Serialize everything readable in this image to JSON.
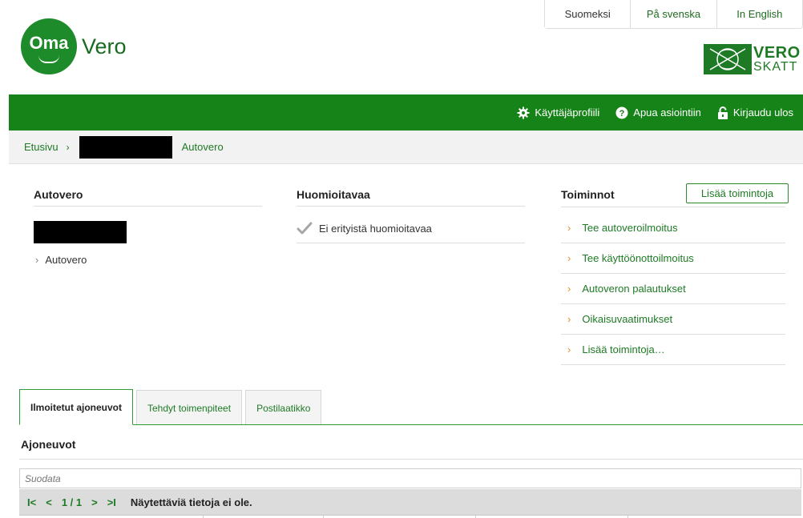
{
  "languages": [
    {
      "label": "Suomeksi",
      "active": true
    },
    {
      "label": "På svenska",
      "active": false
    },
    {
      "label": "In English",
      "active": false
    }
  ],
  "logo": {
    "oma": "Oma",
    "vero": "Vero"
  },
  "vs_logo": {
    "vero": "VERO",
    "skatt": "SKATT"
  },
  "nav": {
    "profile": "Käyttäjäprofiili",
    "help": "Apua asiointiin",
    "logout": "Kirjaudu ulos"
  },
  "breadcrumb": {
    "home": "Etusivu",
    "current": "Autovero"
  },
  "autovero_panel": {
    "title": "Autovero",
    "link": "Autovero"
  },
  "huomioitavaa_panel": {
    "title": "Huomioitavaa",
    "text": "Ei erityistä huomioitavaa"
  },
  "toiminnot_panel": {
    "title": "Toiminnot",
    "button": "Lisää toimintoja",
    "actions": [
      "Tee autoveroilmoitus",
      "Tee käyttöönottoilmoitus",
      "Autoveron palautukset",
      "Oikaisuvaatimukset",
      "Lisää toimintoja…"
    ]
  },
  "tabs": [
    {
      "label": "Ilmoitetut ajoneuvot",
      "active": true
    },
    {
      "label": "Tehdyt toimenpiteet",
      "active": false
    },
    {
      "label": "Postilaatikko",
      "active": false
    }
  ],
  "vehicles": {
    "title": "Ajoneuvot",
    "filter_placeholder": "Suodata",
    "pager": {
      "first": "I<",
      "prev": "<",
      "page": "1 / 1",
      "next": ">",
      "last": ">I",
      "message": "Näytettäviä tietoja ei ole."
    }
  },
  "colors": {
    "brand_green": "#168318",
    "link_green": "#1e7a25",
    "arrow_orange": "#e0912a"
  }
}
